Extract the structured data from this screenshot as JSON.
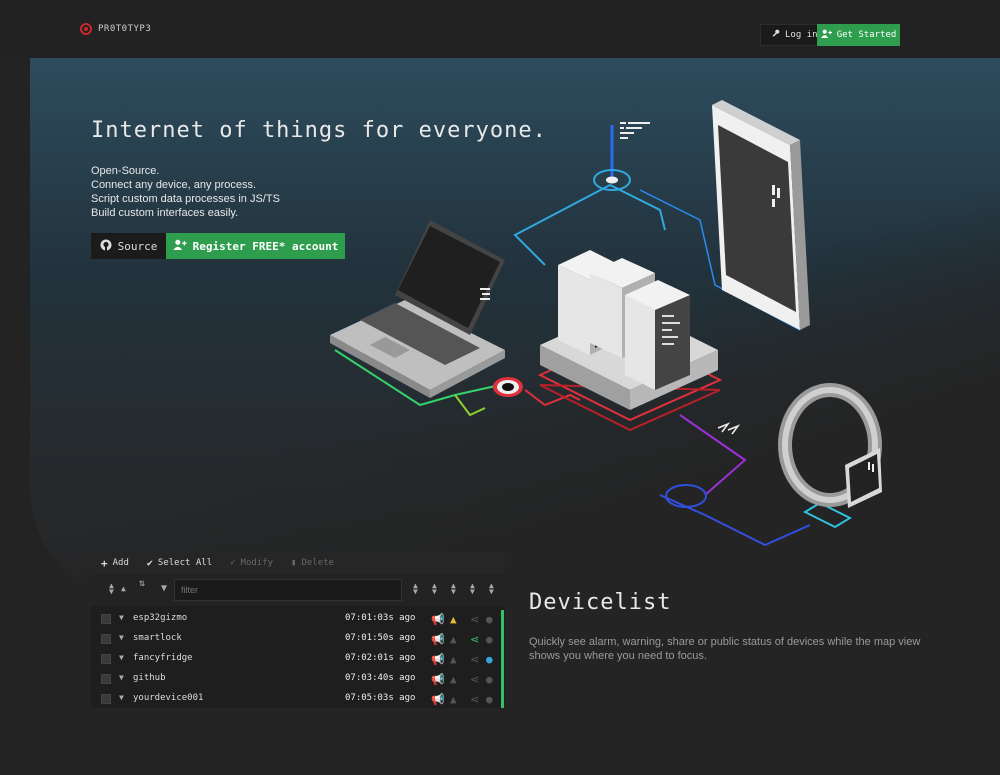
{
  "header": {
    "logo_text": "PR0T0TYP3",
    "login_label": "Log in",
    "get_started_label": "Get Started"
  },
  "hero": {
    "title": "Internet of things for everyone.",
    "lines": [
      "Open-Source.",
      "Connect any device, any process.",
      "Script custom data processes in JS/TS",
      "Build custom interfaces easily."
    ],
    "source_label": "Source",
    "register_label": "Register FREE* account"
  },
  "devicelist": {
    "toolbar": {
      "add": "Add",
      "select_all": "Select All",
      "modify": "Modify",
      "delete": "Delete"
    },
    "filter_placeholder": "filter",
    "rows": [
      {
        "name": "esp32gizmo",
        "time": "07:01:03s ago",
        "alarm": false,
        "warning": true,
        "share": false,
        "public": false
      },
      {
        "name": "smartlock",
        "time": "07:01:50s ago",
        "alarm": true,
        "warning": false,
        "share": true,
        "public": false
      },
      {
        "name": "fancyfridge",
        "time": "07:02:01s ago",
        "alarm": false,
        "warning": false,
        "share": false,
        "public": true
      },
      {
        "name": "github",
        "time": "07:03:40s ago",
        "alarm": false,
        "warning": false,
        "share": false,
        "public": false
      },
      {
        "name": "yourdevice001",
        "time": "07:05:03s ago",
        "alarm": false,
        "warning": false,
        "share": false,
        "public": false
      }
    ],
    "title": "Devicelist",
    "description": "Quickly see alarm, warning, share or public status of devices while the map view shows you where you need to focus."
  },
  "colors": {
    "accent_green": "#2f9d4e",
    "alarm_red": "#e0303e",
    "warning_yellow": "#e8b830",
    "share_green": "#34c06a",
    "public_blue": "#3aa0d8"
  }
}
